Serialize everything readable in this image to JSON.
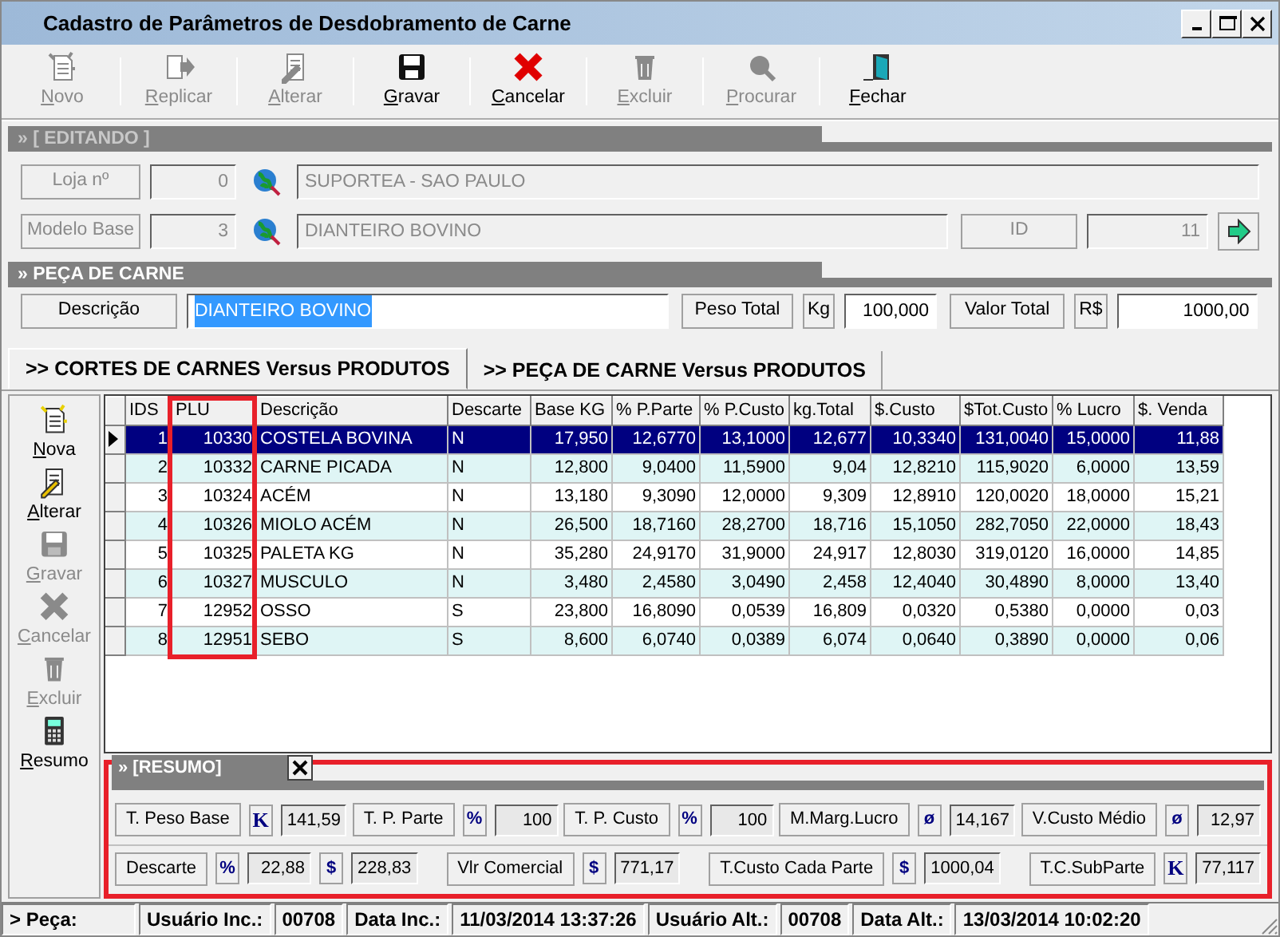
{
  "window": {
    "title": "Cadastro de Parâmetros de Desdobramento de Carne"
  },
  "toolbar": [
    {
      "label": "Novo",
      "kind": "new",
      "enabled": false
    },
    {
      "label": "Replicar",
      "kind": "copy",
      "enabled": false
    },
    {
      "label": "Alterar",
      "kind": "edit",
      "enabled": false
    },
    {
      "label": "Gravar",
      "kind": "save",
      "enabled": true
    },
    {
      "label": "Cancelar",
      "kind": "cancel",
      "enabled": true
    },
    {
      "label": "Excluir",
      "kind": "delete",
      "enabled": false
    },
    {
      "label": "Procurar",
      "kind": "search",
      "enabled": false
    },
    {
      "label": "Fechar",
      "kind": "exit",
      "enabled": true
    }
  ],
  "editing_section": {
    "title": "» [ EDITANDO ]",
    "disabled": true,
    "loja": {
      "label": "Loja nº",
      "code": "0",
      "name": "SUPORTEA - SAO PAULO"
    },
    "modelo_base": {
      "label": "Modelo Base",
      "code": "3",
      "name": "DIANTEIRO BOVINO"
    },
    "id": {
      "label": "ID",
      "value": "11"
    }
  },
  "piece_section": {
    "title": "» PEÇA DE CARNE",
    "description": {
      "label": "Descrição",
      "value": "DIANTEIRO BOVINO",
      "text_selected": true
    },
    "peso_total": {
      "label": "Peso Total",
      "unit": "Kg",
      "value": "100,000"
    },
    "valor_total": {
      "label": "Valor Total",
      "unit": "R$",
      "value": "1000,00"
    }
  },
  "tabs": [
    {
      "label": ">> CORTES DE CARNES Versus PRODUTOS",
      "selected": true
    },
    {
      "label": ">> PEÇA DE CARNE Versus PRODUTOS",
      "selected": false
    }
  ],
  "side_actions": [
    {
      "label": "Nova",
      "kind": "new",
      "enabled": true
    },
    {
      "label": "Alterar",
      "kind": "edit",
      "enabled": true
    },
    {
      "label": "Gravar",
      "kind": "save",
      "enabled": false
    },
    {
      "label": "Cancelar",
      "kind": "cancel",
      "enabled": false
    },
    {
      "label": "Excluir",
      "kind": "delete",
      "enabled": false
    },
    {
      "label": "Resumo",
      "kind": "calculator",
      "enabled": true
    }
  ],
  "table": {
    "columns": [
      {
        "label": "IDS",
        "kind": "number",
        "highlighted": false
      },
      {
        "label": "PLU",
        "kind": "number",
        "highlighted": true
      },
      {
        "label": "Descrição",
        "kind": "text",
        "highlighted": false
      },
      {
        "label": "Descarte",
        "kind": "text",
        "highlighted": false
      },
      {
        "label": "Base KG",
        "kind": "number",
        "highlighted": false
      },
      {
        "label": "% P.Parte",
        "kind": "number",
        "highlighted": false
      },
      {
        "label": "% P.Custo",
        "kind": "number",
        "highlighted": false
      },
      {
        "label": "kg.Total",
        "kind": "number",
        "highlighted": false
      },
      {
        "label": "$.Custo",
        "kind": "number",
        "highlighted": false
      },
      {
        "label": "$Tot.Custo",
        "kind": "number",
        "highlighted": false
      },
      {
        "label": "% Lucro",
        "kind": "number",
        "highlighted": false
      },
      {
        "label": "$. Venda",
        "kind": "number",
        "highlighted": false
      }
    ],
    "rows": [
      {
        "selected": true,
        "cells": [
          "1",
          "10330",
          "COSTELA BOVINA",
          "N",
          "17,950",
          "12,6770",
          "13,1000",
          "12,677",
          "10,3340",
          "131,0040",
          "15,0000",
          "11,88"
        ]
      },
      {
        "selected": false,
        "cells": [
          "2",
          "10332",
          "CARNE PICADA",
          "N",
          "12,800",
          "9,0400",
          "11,5900",
          "9,04",
          "12,8210",
          "115,9020",
          "6,0000",
          "13,59"
        ]
      },
      {
        "selected": false,
        "cells": [
          "3",
          "10324",
          "ACÉM",
          "N",
          "13,180",
          "9,3090",
          "12,0000",
          "9,309",
          "12,8910",
          "120,0020",
          "18,0000",
          "15,21"
        ]
      },
      {
        "selected": false,
        "cells": [
          "4",
          "10326",
          "MIOLO ACÉM",
          "N",
          "26,500",
          "18,7160",
          "28,2700",
          "18,716",
          "15,1050",
          "282,7050",
          "22,0000",
          "18,43"
        ]
      },
      {
        "selected": false,
        "cells": [
          "5",
          "10325",
          "PALETA KG",
          "N",
          "35,280",
          "24,9170",
          "31,9000",
          "24,917",
          "12,8030",
          "319,0120",
          "16,0000",
          "14,85"
        ]
      },
      {
        "selected": false,
        "cells": [
          "6",
          "10327",
          "MUSCULO",
          "N",
          "3,480",
          "2,4580",
          "3,0490",
          "2,458",
          "12,4040",
          "30,4890",
          "8,0000",
          "13,40"
        ]
      },
      {
        "selected": false,
        "cells": [
          "7",
          "12952",
          "OSSO",
          "S",
          "23,800",
          "16,8090",
          "0,0539",
          "16,809",
          "0,0320",
          "0,5380",
          "0,0000",
          "0,03"
        ]
      },
      {
        "selected": false,
        "cells": [
          "8",
          "12951",
          "SEBO",
          "S",
          "8,600",
          "6,0740",
          "0,0389",
          "6,074",
          "0,0640",
          "0,3890",
          "0,0000",
          "0,06"
        ]
      }
    ]
  },
  "summary": {
    "title": "» [RESUMO]",
    "highlighted": true,
    "closable": true,
    "lines": [
      {
        "fields": [
          {
            "label": "T. Peso Base",
            "parts": [
              {
                "unit": "K",
                "value": "141,59"
              }
            ]
          },
          {
            "label": "T. P. Parte",
            "parts": [
              {
                "unit": "%",
                "value": "100"
              }
            ]
          },
          {
            "label": "T. P. Custo",
            "parts": [
              {
                "unit": "%",
                "value": "100"
              }
            ]
          },
          {
            "label": "M.Marg.Lucro",
            "parts": [
              {
                "unit": "ø",
                "value": "14,167"
              }
            ]
          },
          {
            "label": "V.Custo Médio",
            "parts": [
              {
                "unit": "ø",
                "value": "12,97"
              }
            ]
          }
        ]
      },
      {
        "fields": [
          {
            "label": "Descarte",
            "parts": [
              {
                "unit": "%",
                "value": "22,88"
              },
              {
                "unit": "$",
                "value": "228,83"
              }
            ]
          },
          {
            "label": "Vlr Comercial",
            "parts": [
              {
                "unit": "$",
                "value": "771,17"
              }
            ]
          },
          {
            "label": "T.Custo Cada Parte",
            "parts": [
              {
                "unit": "$",
                "value": "1000,04"
              }
            ]
          },
          {
            "label": "T.C.SubParte",
            "parts": [
              {
                "unit": "K",
                "value": "77,117"
              }
            ]
          }
        ]
      }
    ]
  },
  "status_bar": [
    "> Peça:",
    "Usuário Inc.:",
    "00708",
    "Data Inc.:",
    "11/03/2014 13:37:26",
    "Usuário Alt.:",
    "00708",
    "Data Alt.:",
    "13/03/2014 10:02:20"
  ]
}
